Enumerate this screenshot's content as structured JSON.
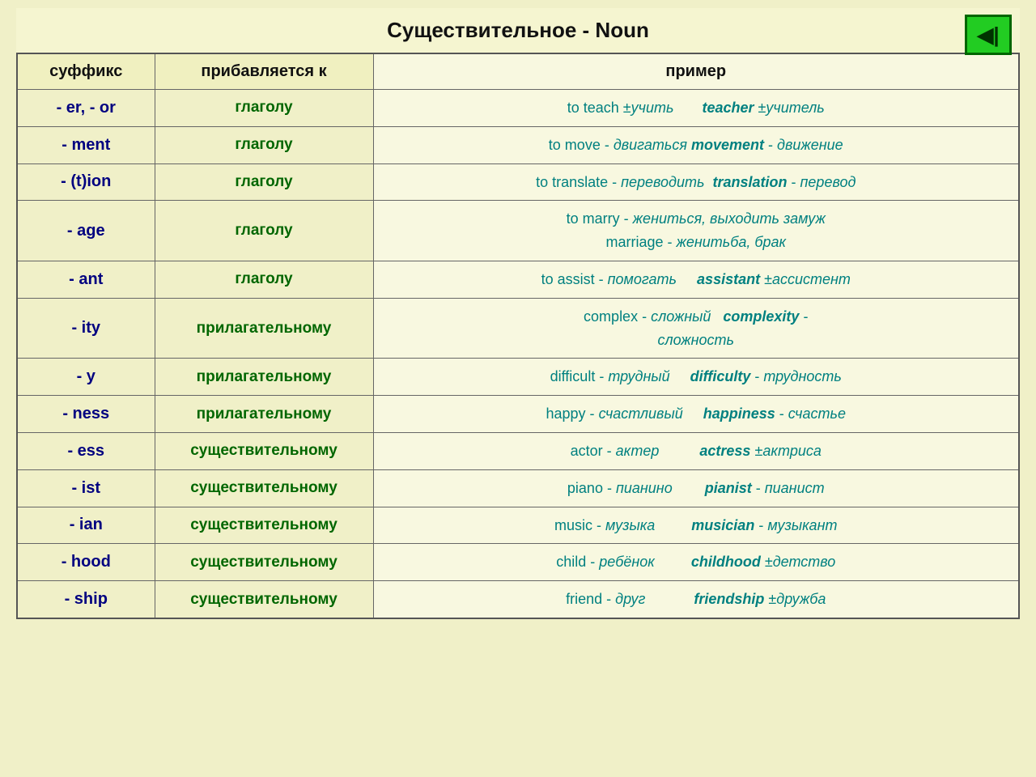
{
  "title": "Существительное - Noun",
  "nav_button": "◀|",
  "headers": {
    "suffix": "суффикс",
    "added_to": "прибавляется к",
    "example": "пример"
  },
  "rows": [
    {
      "suffix": "- er, - or",
      "added_to": "глаголу",
      "example_html": "to teach ±<i>учить</i> &nbsp;&nbsp;&nbsp;&nbsp;&nbsp; <b><i>teacher</i></b> ±<i>учитель</i>"
    },
    {
      "suffix": "- ment",
      "added_to": "глаголу",
      "example_html": "to move - <i>двигаться</i> <b><i>movement</i></b> - <i>движение</i>"
    },
    {
      "suffix": "- (t)ion",
      "added_to": "глаголу",
      "example_html": "to translate - <i>переводить</i> &nbsp;<b><i>translation</i></b> - <i>перевод</i>"
    },
    {
      "suffix": "- age",
      "added_to": "глаголу",
      "example_html": "to marry - <i>жениться, выходить замуж</i><br>marriage - <i>женитьба, брак</i>"
    },
    {
      "suffix": "- ant",
      "added_to": "глаголу",
      "example_html": "to assist - <i>помогать</i> &nbsp;&nbsp;&nbsp; <b><i>assistant</i></b> ±<i>ассистент</i>"
    },
    {
      "suffix": "- ity",
      "added_to": "прилагательному",
      "example_html": "complex - <i>сложный</i> &nbsp; <b><i>complexity</i></b> -<br><i>сложность</i>"
    },
    {
      "suffix": "- y",
      "added_to": "прилагательному",
      "example_html": "difficult - <i>трудный</i> &nbsp;&nbsp;&nbsp; <b><i>difficulty</i></b> - <i>трудность</i>"
    },
    {
      "suffix": "- ness",
      "added_to": "прилагательному",
      "example_html": "happy - <i>счастливый</i> &nbsp;&nbsp;&nbsp; <b><i>happiness</i></b> - <i>счастье</i>"
    },
    {
      "suffix": "- ess",
      "added_to": "существительному",
      "example_html": "actor - <i>актер</i> &nbsp;&nbsp;&nbsp;&nbsp;&nbsp;&nbsp;&nbsp;&nbsp; <b><i>actress</i></b> ±<i>актриса</i>"
    },
    {
      "suffix": "- ist",
      "added_to": "существительному",
      "example_html": "piano - <i>пианино</i> &nbsp;&nbsp;&nbsp;&nbsp;&nbsp;&nbsp; <b><i>pianist</i></b> - <i>пианист</i>"
    },
    {
      "suffix": "- ian",
      "added_to": "существительному",
      "example_html": "music - <i>музыка</i> &nbsp;&nbsp;&nbsp;&nbsp;&nbsp;&nbsp;&nbsp; <b><i>musician</i></b> - <i>музыкант</i>"
    },
    {
      "suffix": "- hood",
      "added_to": "существительному",
      "example_html": "child - <i>ребёнок</i> &nbsp;&nbsp;&nbsp;&nbsp;&nbsp;&nbsp;&nbsp; <b><i>childhood</i></b> ±<i>детство</i>"
    },
    {
      "suffix": "- ship",
      "added_to": "существительному",
      "example_html": "friend - <i>друг</i> &nbsp;&nbsp;&nbsp;&nbsp;&nbsp;&nbsp;&nbsp;&nbsp;&nbsp;&nbsp; <b><i>friendship</i></b> ±<i>дружба</i>"
    }
  ]
}
